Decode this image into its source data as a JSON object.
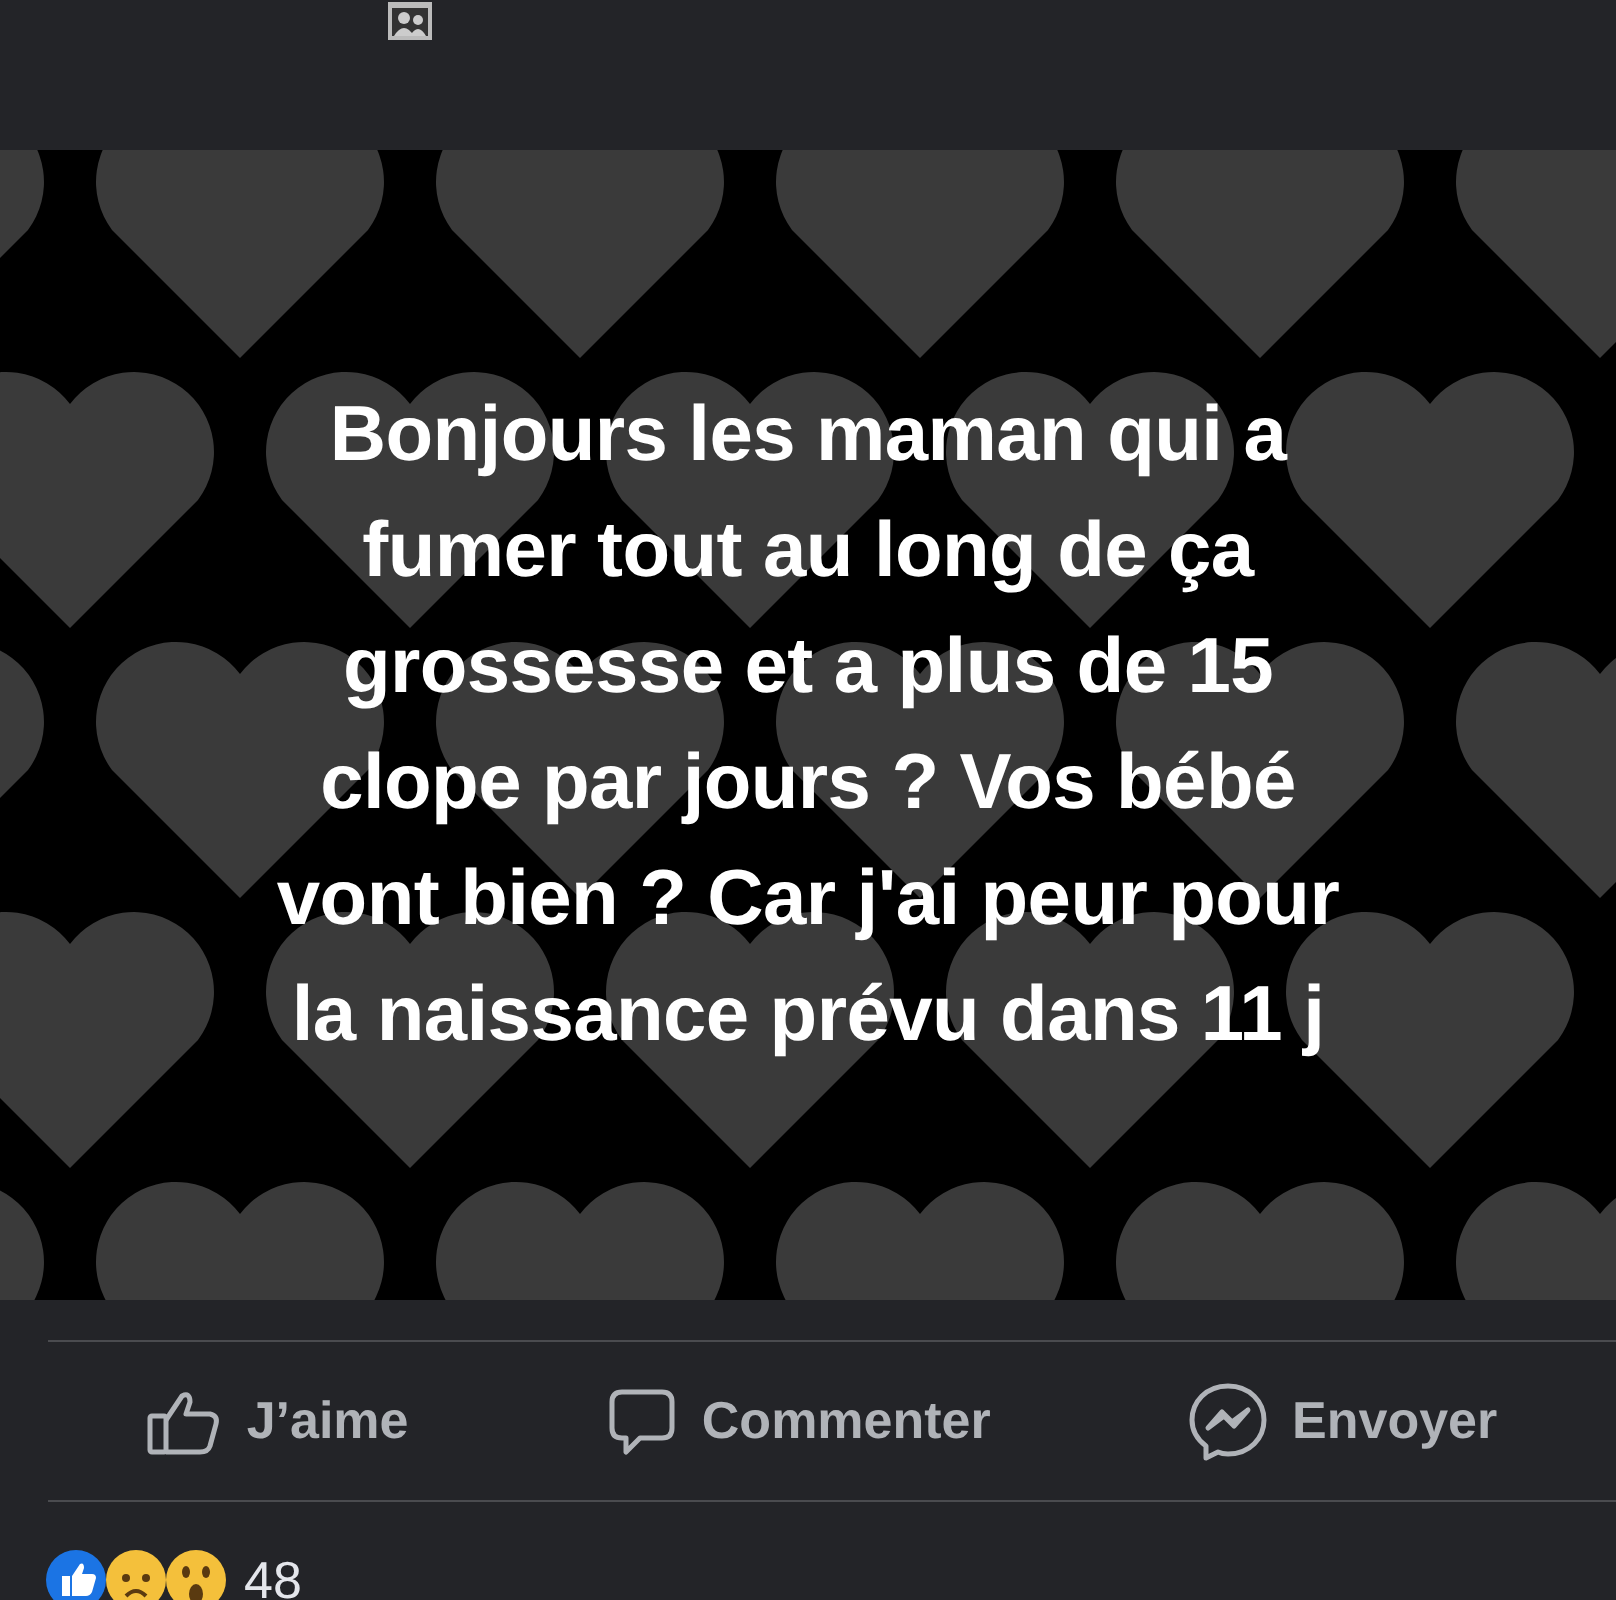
{
  "post": {
    "text": "Bonjours les maman qui a\nfumer tout au long de ça\ngrossesse et a plus de 15\nclope par jours ? Vos bébé\nvont bien ? Car j'ai peur pour\nla naissance prévu dans 11 j"
  },
  "actions": [
    {
      "kind": "like",
      "label": "J’aime"
    },
    {
      "kind": "comment",
      "label": "Commenter"
    },
    {
      "kind": "send",
      "label": "Envoyer"
    }
  ],
  "reactions": {
    "icons": [
      {
        "kind": "like"
      },
      {
        "kind": "sad"
      },
      {
        "kind": "wow"
      }
    ],
    "count": "48"
  }
}
